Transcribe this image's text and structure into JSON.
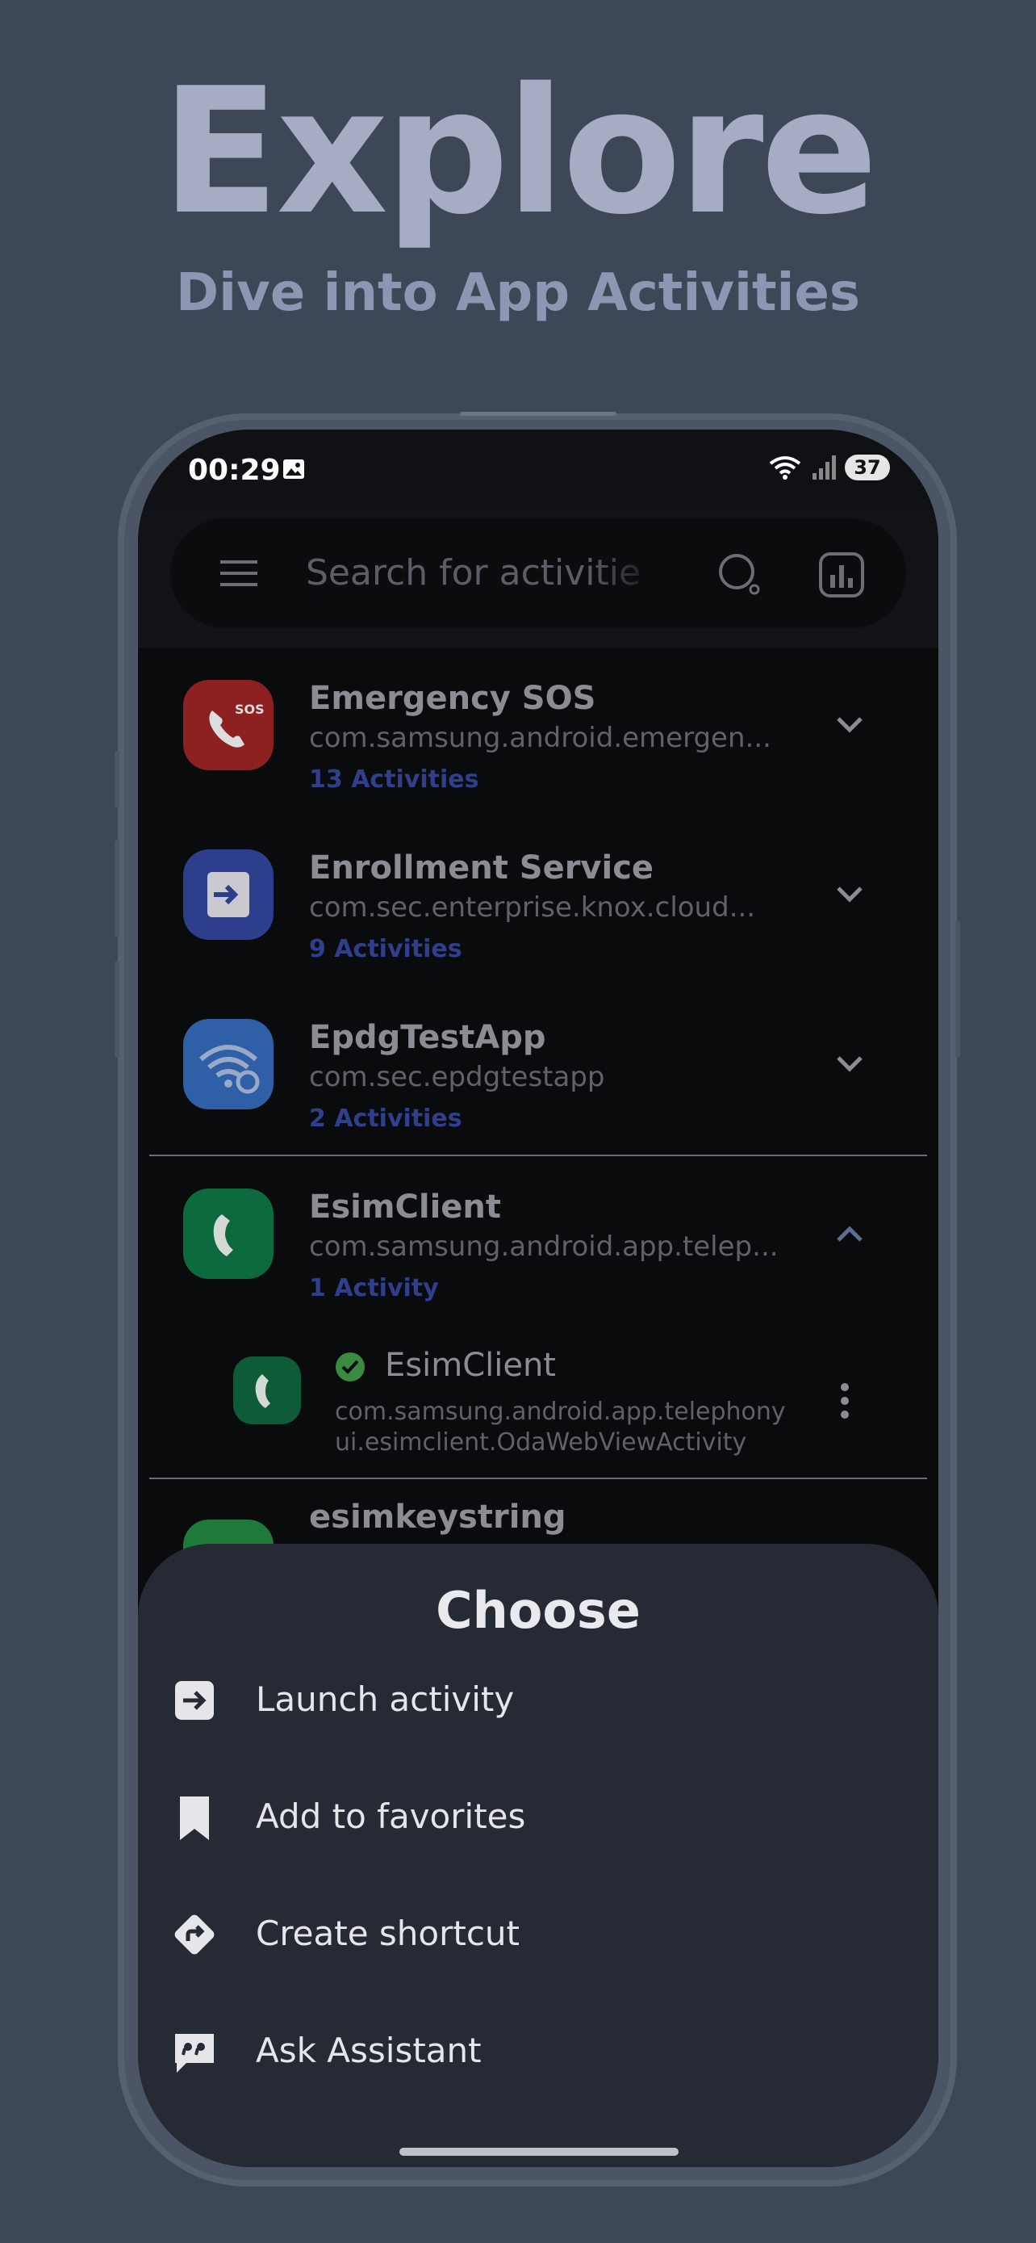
{
  "hero": {
    "title": "Explore",
    "subtitle": "Dive into App Activities"
  },
  "status_bar": {
    "time": "00:29",
    "battery": "37"
  },
  "search": {
    "placeholder": "Search for activitie"
  },
  "apps": [
    {
      "name": "Emergency SOS",
      "package": "com.samsung.android.emergen...",
      "count": "13 Activities",
      "icon": "sos-phone-icon",
      "color": "#8d2121",
      "expanded": false
    },
    {
      "name": "Enrollment Service",
      "package": "com.sec.enterprise.knox.cloud...",
      "count": "9 Activities",
      "icon": "enroll-icon",
      "color": "#2d3e8c",
      "expanded": false
    },
    {
      "name": "EpdgTestApp",
      "package": "com.sec.epdgtestapp",
      "count": "2 Activities",
      "icon": "wifi-gear-icon",
      "color": "#2f5fa7",
      "expanded": false
    },
    {
      "name": "EsimClient",
      "package": "com.samsung.android.app.telep...",
      "count": "1 Activity",
      "icon": "esim-phone-icon",
      "color": "#0d6a3e",
      "expanded": true
    },
    {
      "name": "esimkeystring",
      "package": "",
      "count": "",
      "icon": "grid-icon",
      "color": "#1e7a3a",
      "expanded": false
    }
  ],
  "activity": {
    "name": "EsimClient",
    "package_line1": "com.samsung.android.app.telephony",
    "package_line2": "ui.esimclient.OdaWebViewActivity"
  },
  "sheet": {
    "title": "Choose",
    "items": [
      {
        "label": "Launch activity",
        "icon": "launch-icon"
      },
      {
        "label": "Add to favorites",
        "icon": "bookmark-icon"
      },
      {
        "label": "Create shortcut",
        "icon": "shortcut-icon"
      },
      {
        "label": "Ask Assistant",
        "icon": "assistant-icon"
      }
    ]
  }
}
